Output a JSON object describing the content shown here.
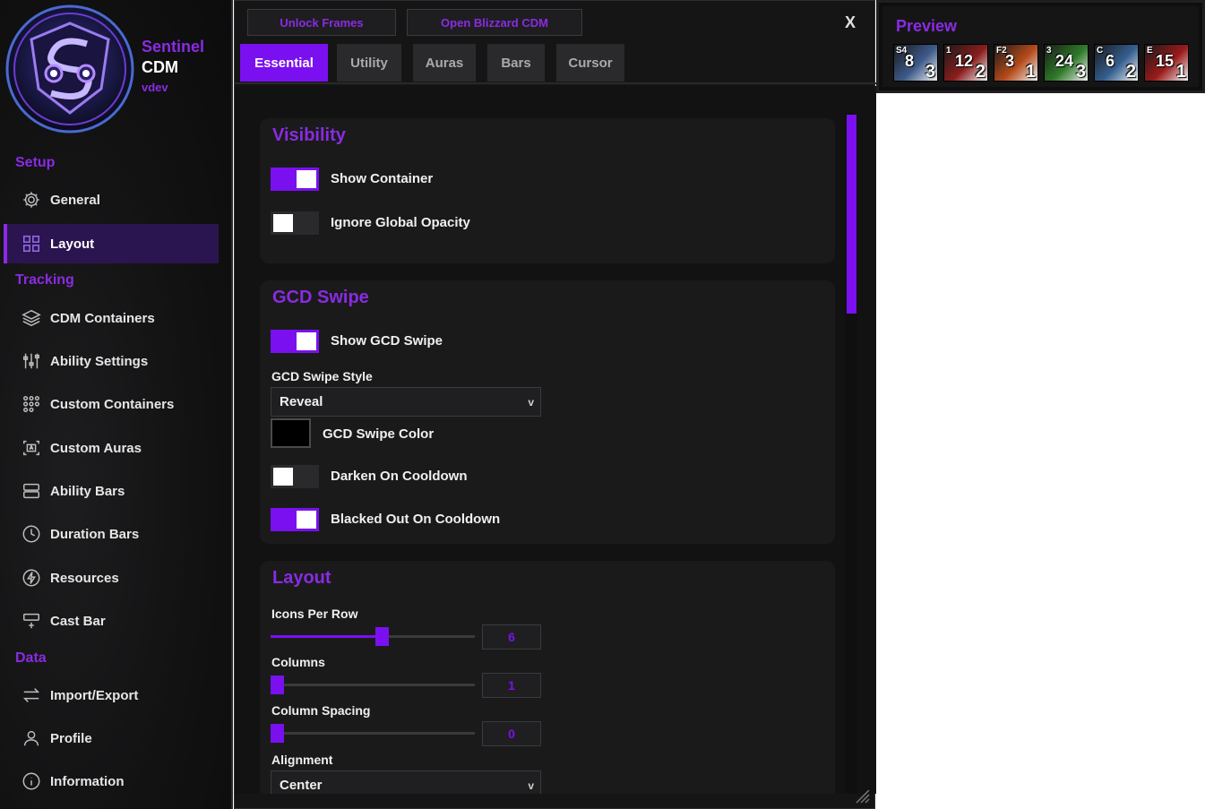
{
  "app": {
    "title": "Sentinel",
    "subtitle": "CDM",
    "version": "vdev"
  },
  "sidebar": {
    "sections": [
      {
        "label": "Setup"
      },
      {
        "label": "Tracking"
      },
      {
        "label": "Data"
      }
    ],
    "items": [
      {
        "label": "General",
        "icon": "gear-icon"
      },
      {
        "label": "Layout",
        "icon": "grid-icon",
        "active": true
      },
      {
        "label": "CDM Containers",
        "icon": "layers-icon"
      },
      {
        "label": "Ability Settings",
        "icon": "sliders-icon"
      },
      {
        "label": "Custom Containers",
        "icon": "dots-grid-icon"
      },
      {
        "label": "Custom Auras",
        "icon": "aura-frame-icon"
      },
      {
        "label": "Ability Bars",
        "icon": "bars-icon"
      },
      {
        "label": "Duration Bars",
        "icon": "clock-icon"
      },
      {
        "label": "Resources",
        "icon": "bolt-icon"
      },
      {
        "label": "Cast Bar",
        "icon": "cast-bar-icon"
      },
      {
        "label": "Import/Export",
        "icon": "arrows-icon"
      },
      {
        "label": "Profile",
        "icon": "user-icon"
      },
      {
        "label": "Information",
        "icon": "info-icon"
      }
    ]
  },
  "toolbar": {
    "unlock_label": "Unlock Frames",
    "open_label": "Open Blizzard CDM",
    "close_label": "X"
  },
  "tabs": [
    {
      "label": "Essential",
      "active": true
    },
    {
      "label": "Utility"
    },
    {
      "label": "Auras"
    },
    {
      "label": "Bars"
    },
    {
      "label": "Cursor"
    }
  ],
  "visibility": {
    "title": "Visibility",
    "show_container": {
      "label": "Show Container",
      "on": true
    },
    "ignore_opacity": {
      "label": "Ignore Global Opacity",
      "on": false
    }
  },
  "gcd": {
    "title": "GCD Swipe",
    "show_swipe": {
      "label": "Show GCD Swipe",
      "on": true
    },
    "style_label": "GCD Swipe Style",
    "style_value": "Reveal",
    "color_label": "GCD Swipe Color",
    "color_value": "#000000",
    "darken": {
      "label": "Darken On Cooldown",
      "on": false
    },
    "blacked": {
      "label": "Blacked Out On Cooldown",
      "on": true
    }
  },
  "layout": {
    "title": "Layout",
    "icons_per_row": {
      "label": "Icons Per Row",
      "value": "6",
      "fraction": 0.55
    },
    "columns": {
      "label": "Columns",
      "value": "1",
      "fraction": 0.0
    },
    "column_spacing": {
      "label": "Column Spacing",
      "value": "0",
      "fraction": 0.0
    },
    "alignment_label": "Alignment",
    "alignment_value": "Center"
  },
  "preview": {
    "title": "Preview",
    "auras": [
      {
        "bind": "S4",
        "cd": "8",
        "stacks": "3",
        "color": "#3d5a8a"
      },
      {
        "bind": "1",
        "cd": "12",
        "stacks": "2",
        "color": "#8a1d1d"
      },
      {
        "bind": "F2",
        "cd": "3",
        "stacks": "1",
        "color": "#b44a1a"
      },
      {
        "bind": "3",
        "cd": "24",
        "stacks": "3",
        "color": "#2f7a2a"
      },
      {
        "bind": "C",
        "cd": "6",
        "stacks": "2",
        "color": "#355f8f"
      },
      {
        "bind": "E",
        "cd": "15",
        "stacks": "1",
        "color": "#9a1a1a"
      }
    ]
  },
  "colors": {
    "accent": "#8a2be2",
    "accent_fill": "#7a10f0"
  }
}
